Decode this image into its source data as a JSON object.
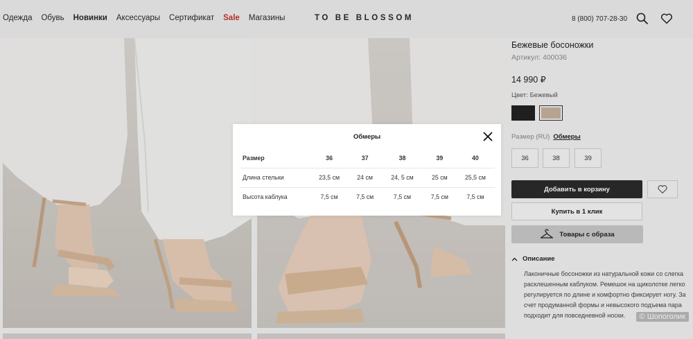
{
  "header": {
    "nav": [
      "Одежда",
      "Обувь",
      "Новинки",
      "Аксессуары",
      "Сертификат",
      "Sale",
      "Магазины"
    ],
    "logo": "TO BE BLOSSOM",
    "phone": "8 (800) 707-28-30"
  },
  "product": {
    "title": "Бежевые босоножки",
    "article": "Артикул: 400036",
    "price": "14 990 ₽",
    "color_label": "Цвет: Бежевый",
    "swatches": [
      "#222222",
      "#c7b19f"
    ],
    "size_label": "Размер (RU)",
    "size_link": "Обмеры",
    "sizes": [
      "36",
      "38",
      "39"
    ],
    "add_to_cart": "Добавить в корзину",
    "buy_one_click": "Купить в 1 клик",
    "look_items": "Товары с образа",
    "description_title": "Описание",
    "description": "Лаконичные босоножки из натуральной кожи со слегка расклешенным каблуком. Ремешок на щиколотке легко регулируется по длине и комфортно фиксирует ногу. За счет продуманной формы и невысокого подъема пара подходит для повседневной носки."
  },
  "watermark": "© Шопоголик",
  "modal": {
    "title": "Обмеры",
    "headers": [
      "Размер",
      "36",
      "37",
      "38",
      "39",
      "40"
    ],
    "rows": [
      [
        "Длина стельки",
        "23,5 см",
        "24 см",
        "24, 5 см",
        "25 см",
        "25,5 см"
      ],
      [
        "Высота каблука",
        "7,5 см",
        "7,5 см",
        "7,5 см",
        "7,5 см",
        "7,5 см"
      ]
    ]
  }
}
